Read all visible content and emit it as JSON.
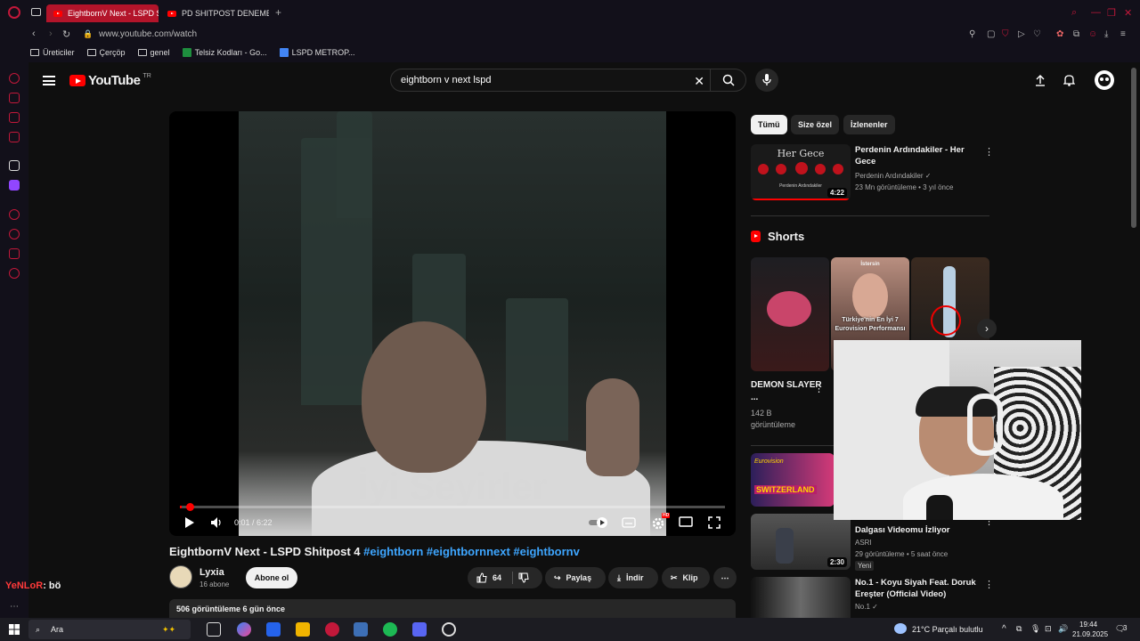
{
  "browser": {
    "tabs": [
      {
        "label": "EightbornV Next - LSPD S"
      },
      {
        "label": "PD SHITPOST DENEMESİ"
      }
    ],
    "url": "www.youtube.com/watch",
    "bookmarks": [
      {
        "label": "Üreticiler"
      },
      {
        "label": "Çerçöp"
      },
      {
        "label": "genel"
      },
      {
        "label": "Telsiz Kodları - Go..."
      },
      {
        "label": "LSPD METROP..."
      }
    ]
  },
  "youtube": {
    "logo_text": "YouTube",
    "region": "TR",
    "search_value": "eightborn v next lspd",
    "player": {
      "caption": "İyi Seyirler",
      "time": "0:01 / 6:22",
      "progress_fraction": 0.0026,
      "hd_badge": "HD"
    },
    "video": {
      "title": "EightbornV Next - LSPD Shitpost 4",
      "tags": "#eightborn #eightbornnext #eightbornv",
      "channel": "Lyxia",
      "subs": "16 abone",
      "subscribe_label": "Abone ol",
      "likes": "64",
      "share_label": "Paylaş",
      "download_label": "İndir",
      "clip_label": "Klip",
      "views_date": "506 görüntüleme  6 gün önce"
    },
    "chips": [
      {
        "label": "Tümü",
        "selected": true
      },
      {
        "label": "Size özel",
        "selected": false
      },
      {
        "label": "İzlenenler",
        "selected": false
      }
    ],
    "recommended": [
      {
        "title": "Perdenin Ardındakiler - Her Gece",
        "channel": "Perdenin Ardındakiler",
        "meta": "23 Mn görüntüleme • 3 yıl önce",
        "duration": "4:22",
        "thumb_text": "Her Gece",
        "thumb_sub": "Perdenin Ardındakiler"
      },
      {
        "title": "Dalgası Videomu İzliyor",
        "channel": "ASRI",
        "meta": "29 görüntüleme • 5 saat önce",
        "badge": "Yeni",
        "duration": "2:30"
      },
      {
        "title": "No.1 - Koyu Siyah Feat. Doruk Ereşter (Official Video)",
        "channel": "No.1"
      }
    ],
    "shorts": {
      "label": "Shorts",
      "items": [
        {
          "title": "DEMON SLAYER ...",
          "views": "142 B görüntüleme"
        },
        {
          "overlay": "Türkiye'nin En İyi 7 Eurovision Performansı",
          "top_label": "İstersin"
        },
        {}
      ]
    },
    "eurovision_thumb": {
      "line1": "Eurovision",
      "line2": "SWITZERLAND"
    }
  },
  "chat": {
    "nick": "YeNLoR",
    "message": ": bö"
  },
  "taskbar": {
    "search_label": "Ara",
    "weather": "21°C  Parçalı bulutlu",
    "time": "19:44",
    "date": "21.09.2025",
    "notif_count": "3"
  },
  "colors": {
    "accent": "#ff0000",
    "browser_accent": "#c2183a",
    "link": "#3ea6ff"
  }
}
